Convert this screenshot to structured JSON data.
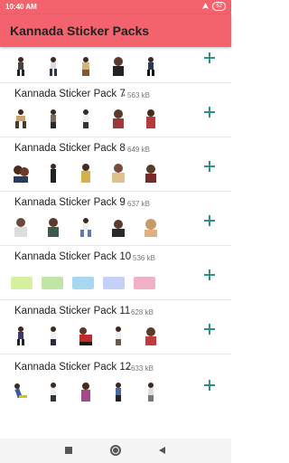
{
  "status": {
    "time": "10:40 AM",
    "battery": "62",
    "icons": [
      "location-icon",
      "battery-icon"
    ]
  },
  "app": {
    "title": "Kannada Sticker Packs"
  },
  "colors": {
    "accent": "#f3636d",
    "plus": "#2f8f86"
  },
  "packs": [
    {
      "name": "",
      "size": ""
    },
    {
      "name": "Kannada Sticker Pack 7",
      "size": "• 563 kB"
    },
    {
      "name": "Kannada Sticker Pack 8",
      "size": "• 649 kB"
    },
    {
      "name": "Kannada Sticker Pack 9",
      "size": "• 637 kB"
    },
    {
      "name": "Kannada Sticker Pack 10",
      "size": "• 536 kB"
    },
    {
      "name": "Kannada Sticker Pack 11",
      "size": "• 628 kB"
    },
    {
      "name": "Kannada Sticker Pack 12",
      "size": "• 633 kB"
    }
  ],
  "nav": {
    "icons": [
      "recents-square-icon",
      "home-circle-icon",
      "back-triangle-icon"
    ]
  }
}
